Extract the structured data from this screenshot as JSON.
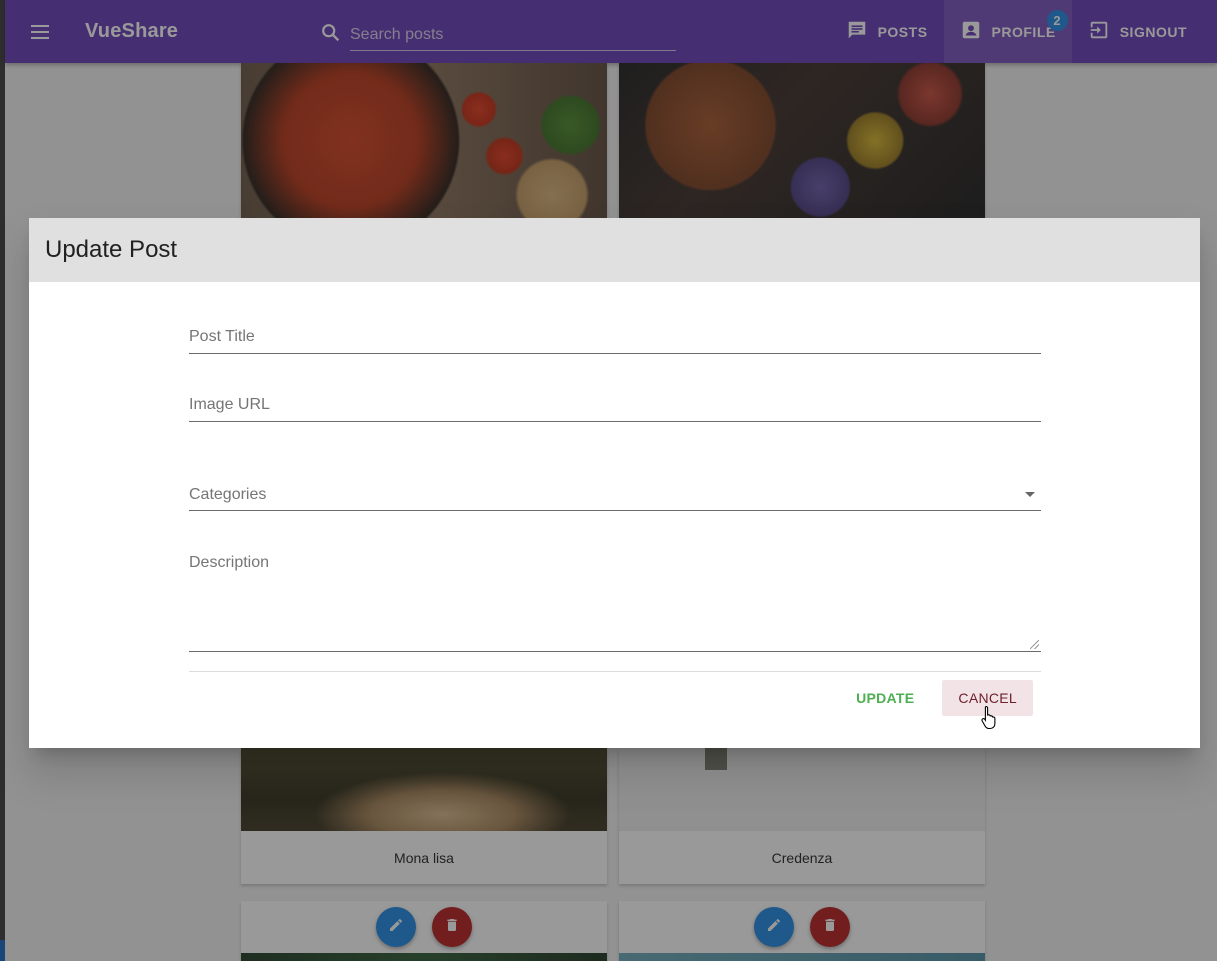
{
  "app": {
    "title": "VueShare"
  },
  "search": {
    "placeholder": "Search posts"
  },
  "nav": {
    "posts": "POSTS",
    "profile": "PROFILE",
    "profile_badge": "2",
    "signout": "SIGNOUT"
  },
  "cards": [
    {
      "title": ""
    },
    {
      "title": ""
    },
    {
      "title": "Mona lisa"
    },
    {
      "title": "Credenza"
    }
  ],
  "dialog": {
    "title": "Update Post",
    "fields": {
      "post_title": {
        "label": "Post Title",
        "value": ""
      },
      "image_url": {
        "label": "Image URL",
        "value": ""
      },
      "categories": {
        "label": "Categories"
      },
      "description": {
        "label": "Description",
        "value": ""
      }
    },
    "update_label": "UPDATE",
    "cancel_label": "CANCEL"
  },
  "colors": {
    "toolbar": "#673ab7",
    "badge": "#1e88e5",
    "update": "#4caf50",
    "cancel": "#6d1f2a"
  }
}
